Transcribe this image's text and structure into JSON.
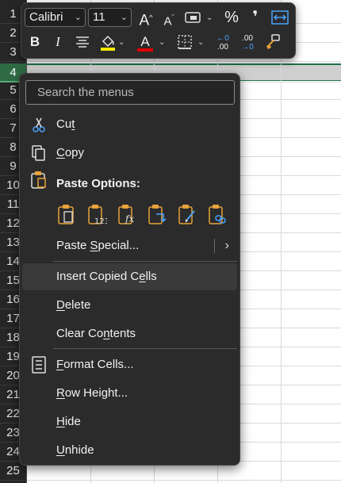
{
  "row_headers": [
    "1",
    "2",
    "3",
    "4",
    "5",
    "6",
    "7",
    "8",
    "9",
    "10",
    "11",
    "12",
    "13",
    "14",
    "15",
    "16",
    "17",
    "18",
    "19",
    "20",
    "21",
    "22",
    "23",
    "24",
    "25"
  ],
  "selected_row": "4",
  "mini_toolbar": {
    "font_name": "Calibri",
    "font_size": "11",
    "increase_font_glyph": "A",
    "decrease_font_glyph": "A",
    "percent_glyph": "%",
    "comma_glyph": "❜",
    "bold_glyph": "B",
    "italic_glyph": "I",
    "highlight_color": "#f6e600",
    "font_color": "#e00000",
    "font_color_glyph": "A",
    "inc_decimal_top": "←0",
    "inc_decimal_bottom": ".00",
    "dec_decimal_top": ".00",
    "dec_decimal_bottom": "→0"
  },
  "context_menu": {
    "search_placeholder": "Search the menus",
    "cut": {
      "before": "Cu",
      "key": "t",
      "after": ""
    },
    "copy": {
      "before": "",
      "key": "C",
      "after": "opy"
    },
    "paste_options_label": "Paste Options:",
    "paste_special": {
      "before": "Paste ",
      "key": "S",
      "after": "pecial..."
    },
    "insert_copied_cells": {
      "before": "Insert Copied C",
      "key": "e",
      "after": "lls"
    },
    "delete": {
      "before": "",
      "key": "D",
      "after": "elete"
    },
    "clear_contents": {
      "before": "Clear Co",
      "key": "n",
      "after": "tents"
    },
    "format_cells": {
      "before": "",
      "key": "F",
      "after": "ormat Cells..."
    },
    "row_height": {
      "before": "",
      "key": "R",
      "after": "ow Height..."
    },
    "hide": {
      "before": "",
      "key": "H",
      "after": "ide"
    },
    "unhide": {
      "before": "",
      "key": "U",
      "after": "nhide"
    }
  },
  "colors": {
    "paste_icon_orange": "#e8a33a",
    "paste_icon_blue": "#4aa3ff",
    "selected_row_green": "#2e6b45"
  }
}
